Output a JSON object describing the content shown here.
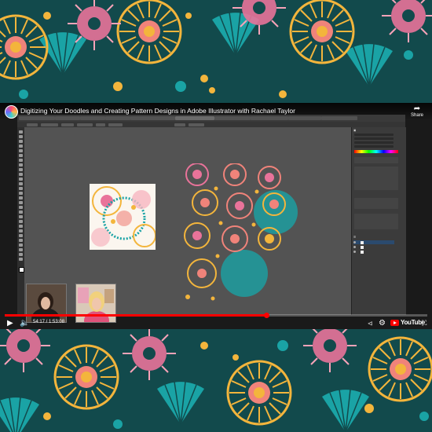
{
  "video": {
    "title": "Digitizing Your Doodles and Creating Pattern Designs in Adobe Illustrator with Rachael Taylor",
    "share_label": "Share",
    "time_display": "54:17 / 1:53:08",
    "progress_fraction": 0.62,
    "logo_text": "YouTube"
  },
  "colors": {
    "teal_dark": "#124a4c",
    "teal": "#1aa3a5",
    "coral": "#f0837a",
    "pink": "#e9739a",
    "yellow": "#f3b53c",
    "progress": "#ff0000"
  },
  "illustrator": {
    "tab_count": 8,
    "panel_headers": [
      "Properties",
      "Color",
      "Swatches",
      "Align",
      "Layers"
    ]
  },
  "icons": {
    "play": "play-icon",
    "volume": "volume-icon",
    "settings": "gear-icon",
    "fullscreen": "fullscreen-icon",
    "share": "share-icon"
  }
}
